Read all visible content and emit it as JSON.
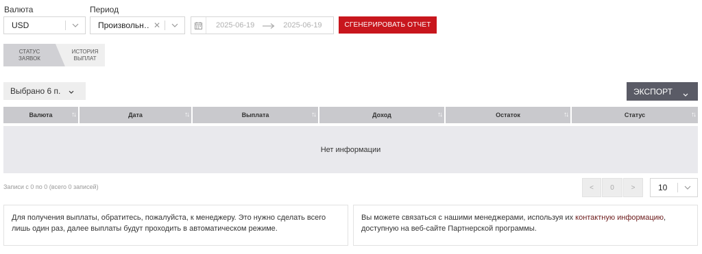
{
  "filters": {
    "currency_label": "Валюта",
    "currency_value": "USD",
    "period_label": "Период",
    "period_value": "Произвольн…",
    "date_from": "2025-06-19",
    "date_to": "2025-06-19",
    "generate_button": "СГЕНЕРИРОВАТЬ ОТЧЕТ"
  },
  "tabs": [
    {
      "line1": "СТАТУС",
      "line2": "ЗАЯВОК",
      "active": true
    },
    {
      "line1": "ИСТОРИЯ",
      "line2": "ВЫПЛАТ",
      "active": false
    }
  ],
  "toolbar": {
    "selected_label": "Выбрано 6 п.",
    "export_label": "ЭКСПОРТ"
  },
  "table": {
    "columns": [
      "Валюта",
      "Дата",
      "Выплата",
      "Доход",
      "Остаток",
      "Статус"
    ],
    "empty_text": "Нет информации"
  },
  "pagination": {
    "records_info": "Записи с 0 по 0 (всего 0 записей)",
    "prev": "<",
    "page": "0",
    "next": ">",
    "page_size": "10"
  },
  "notes": {
    "left": "Для получения выплаты, обратитесь, пожалуйста, к менеджеру. Это нужно сделать всего лишь один раз, далее выплаты будут проходить в автоматическом режиме.",
    "right_before": "Вы можете связаться с нашими менеджерами, используя их ",
    "right_link": "контактную информацию",
    "right_after": ", доступную на веб-сайте Партнерской программы."
  },
  "colors": {
    "accent_red": "#c8161d",
    "export_bg": "#5a5b66",
    "header_bg": "#c9c9cd"
  }
}
